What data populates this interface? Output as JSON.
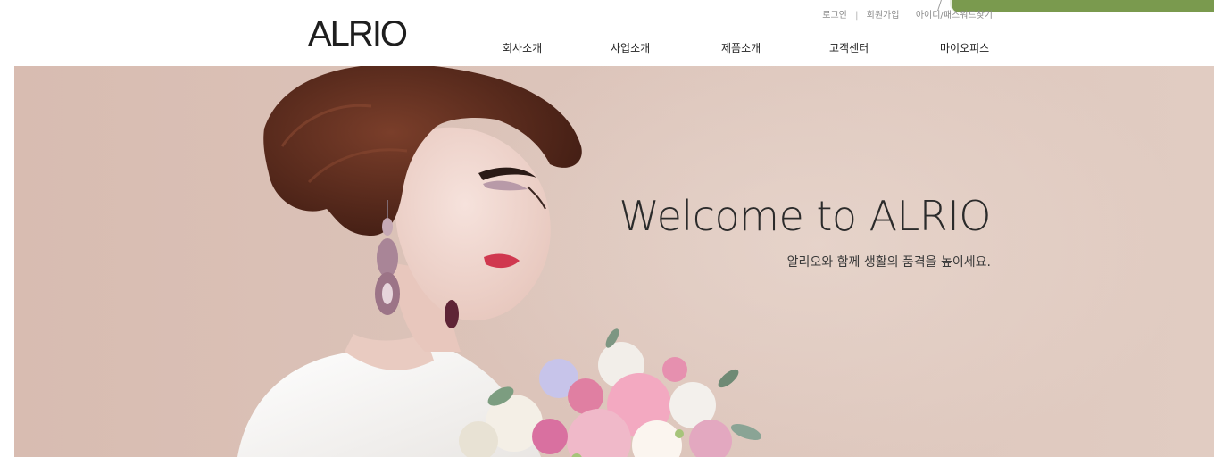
{
  "header": {
    "logo": "ALRIO",
    "util_links": {
      "login": "로그인",
      "separator": "|",
      "signup": "회원가입",
      "find_account": "아이디/패스워드찾기"
    },
    "nav": [
      {
        "label": "회사소개"
      },
      {
        "label": "사업소개"
      },
      {
        "label": "제품소개"
      },
      {
        "label": "고객센터"
      },
      {
        "label": "마이오피스"
      }
    ],
    "corner_tab_color": "#7a9a4e"
  },
  "hero": {
    "title": "Welcome to ALRIO",
    "subtitle": "알리오와 함께 생활의 품격을 높이세요.",
    "background_color": "#dcc4ba"
  }
}
